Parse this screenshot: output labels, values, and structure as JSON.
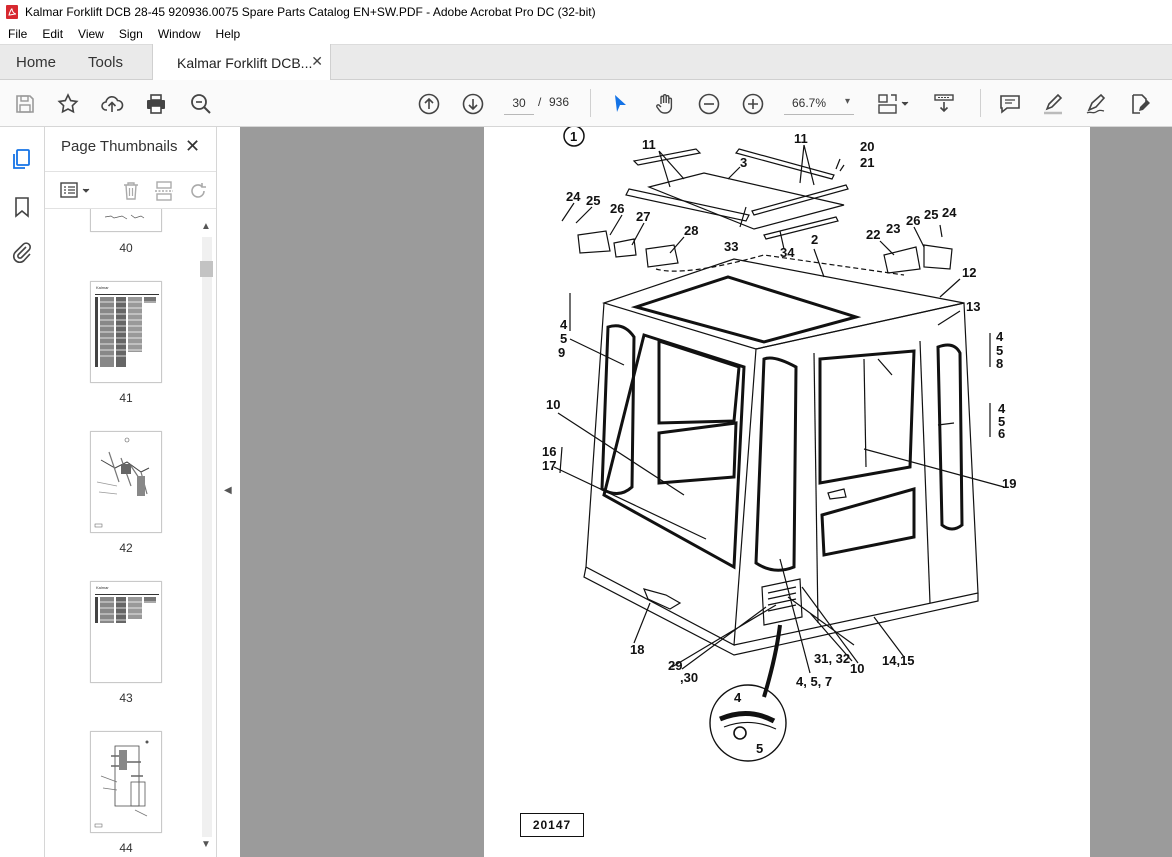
{
  "window": {
    "title": "Kalmar Forklift DCB 28-45 920936.0075 Spare Parts Catalog EN+SW.PDF - Adobe Acrobat Pro DC (32-bit)"
  },
  "menu": [
    "File",
    "Edit",
    "View",
    "Sign",
    "Window",
    "Help"
  ],
  "tabs": {
    "home": "Home",
    "tools": "Tools",
    "document": "Kalmar Forklift DCB...",
    "close_glyph": "✕"
  },
  "toolbar": {
    "current_page": "30",
    "separator": "/",
    "total_pages": "936",
    "zoom": "66.7%",
    "zoom_caret": "▾"
  },
  "panel": {
    "title": "Page Thumbnails",
    "close_glyph": "✕",
    "thumbnails": [
      {
        "label": "40"
      },
      {
        "label": "41"
      },
      {
        "label": "42"
      },
      {
        "label": "43"
      },
      {
        "label": "44"
      }
    ]
  },
  "drawing": {
    "circle_number": "1",
    "drawing_number": "20147",
    "callouts": [
      "11",
      "11",
      "3",
      "20",
      "21",
      "24",
      "25",
      "26",
      "27",
      "28",
      "33",
      "34",
      "2",
      "22",
      "23",
      "26",
      "25",
      "24",
      "12",
      "13",
      "4",
      "5",
      "9",
      "4",
      "5",
      "8",
      "10",
      "4",
      "5",
      "6",
      "16",
      "17",
      "19",
      "18",
      "29",
      ",30",
      "31, 32",
      "10",
      "14,15",
      "4, 5, 7",
      "4",
      "5"
    ]
  },
  "colors": {
    "acrobat_red": "#d7282f",
    "canvas_grey": "#9b9b9b",
    "active_icon_blue": "#1473e6"
  }
}
